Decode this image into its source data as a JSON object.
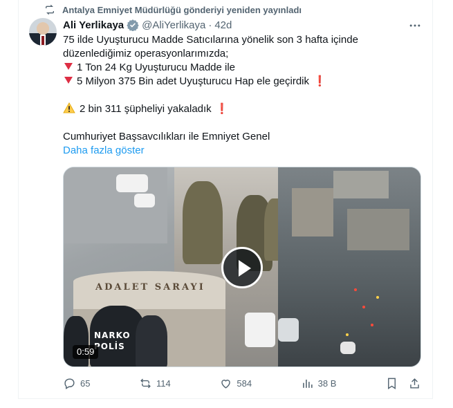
{
  "repost": {
    "text": "Antalya Emniyet Müdürlüğü gönderiyi yeniden yayınladı",
    "icon": "repost-icon"
  },
  "author": {
    "name": "Ali Yerlikaya",
    "handle": "@AliYerlikaya",
    "separator": "·",
    "time": "42d",
    "verified_icon": "verified-badge-icon",
    "verified_color": "#829aab"
  },
  "tweet": {
    "line1": "75 ilde Uyuşturucu Madde Satıcılarına yönelik son 3 hafta içinde",
    "line2": "düzenlediğimiz operasyonlarımızda;",
    "line3": "1 Ton 24 Kg Uyuşturucu Madde ile",
    "line4": "5 Milyon 375 Bin adet Uyuşturucu Hap ele geçirdik",
    "line5": "2 bin 311 şüpheliyi yakaladık",
    "line6": "Cumhuriyet Başsavcılıkları ile Emniyet Genel",
    "show_more": "Daha fazla göster",
    "exclamation": "❗"
  },
  "media": {
    "duration": "0:59",
    "court_sign": "ADALET SARAYI",
    "vest_text_1": "NARKO",
    "vest_text_2": "POLİS"
  },
  "actions": {
    "replies": "65",
    "reposts": "114",
    "likes": "584",
    "views": "38 B"
  },
  "colors": {
    "accent": "#1d9bf0",
    "muted": "#536471",
    "red": "#dd2e44"
  }
}
